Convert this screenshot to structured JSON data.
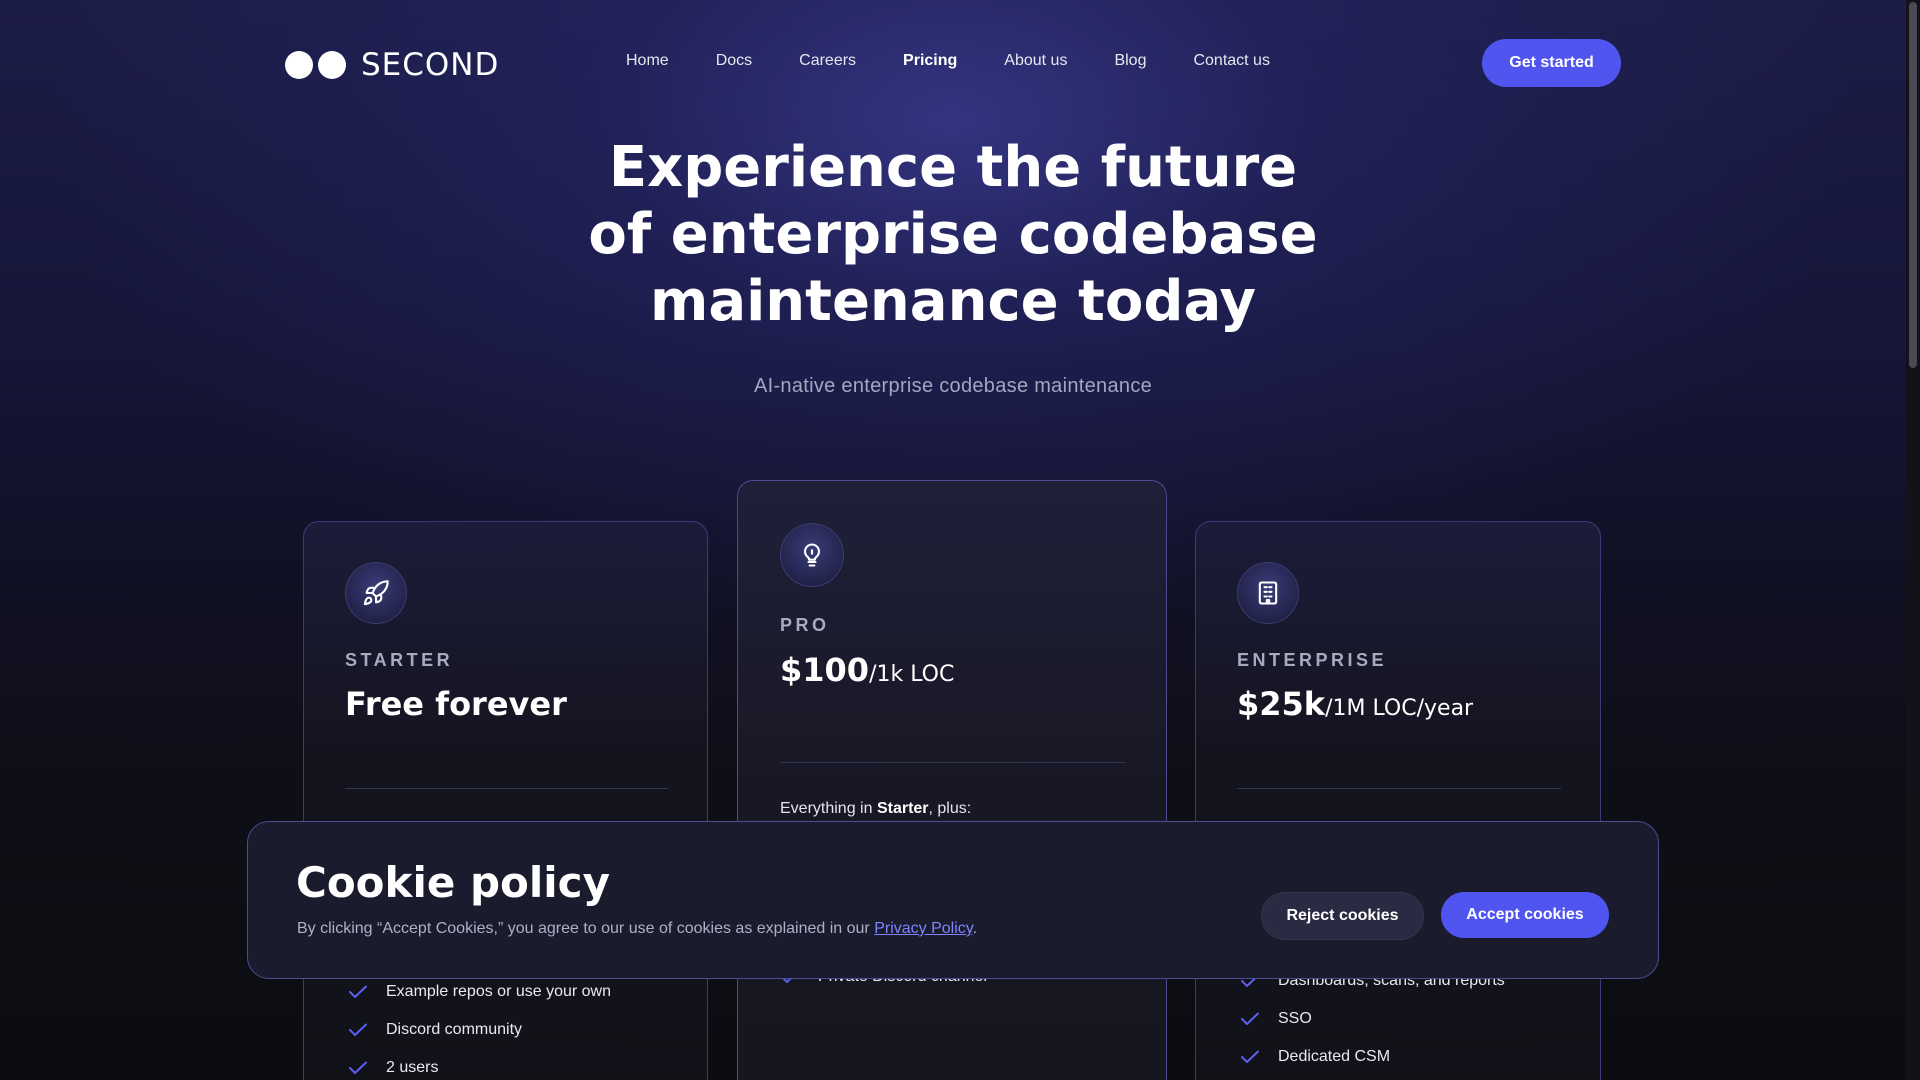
{
  "brand": {
    "name": "SECOND"
  },
  "nav": {
    "items": [
      {
        "label": "Home",
        "active": false
      },
      {
        "label": "Docs",
        "active": false
      },
      {
        "label": "Careers",
        "active": false
      },
      {
        "label": "Pricing",
        "active": true
      },
      {
        "label": "About us",
        "active": false
      },
      {
        "label": "Blog",
        "active": false
      },
      {
        "label": "Contact us",
        "active": false
      }
    ],
    "cta": "Get started"
  },
  "hero": {
    "title_lines": [
      "Experience the future",
      "of enterprise codebase",
      "maintenance today"
    ],
    "subtitle": "AI-native enterprise codebase maintenance"
  },
  "plans": [
    {
      "icon": "rocket-icon",
      "name": "STARTER",
      "price": "Free forever",
      "unit": "",
      "features": [
        "Example repos or use your own",
        "Discord community",
        "2 users"
      ]
    },
    {
      "icon": "lightbulb-icon",
      "name": "PRO",
      "price": "$100",
      "unit": "/1k LOC",
      "everything_prefix": "Everything in ",
      "everything_plan": "Starter",
      "everything_suffix": ", plus:",
      "features": [
        "Private Discord channel"
      ]
    },
    {
      "icon": "building-icon",
      "name": "ENTERPRISE",
      "price": "$25k",
      "unit": "/1M LOC/year",
      "features": [
        "Dashboards, scans, and reports",
        "SSO",
        "Dedicated CSM"
      ]
    }
  ],
  "cookie": {
    "title": "Cookie policy",
    "text_before": "By clicking “Accept Cookies,” you agree to our use of cookies as explained in our ",
    "link": "Privacy Policy",
    "text_after": ".",
    "reject": "Reject cookies",
    "accept": "Accept cookies"
  },
  "colors": {
    "accent": "#5055f0",
    "link": "#7f84ff",
    "check": "#5b60f2"
  }
}
